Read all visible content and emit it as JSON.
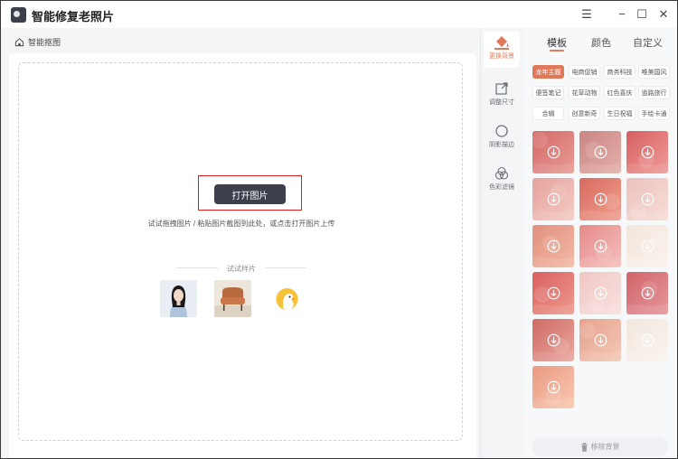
{
  "app": {
    "title": "智能修复老照片"
  },
  "window_controls": {
    "menu": "☰",
    "minimize": "−",
    "maximize": "☐",
    "close": "✕"
  },
  "breadcrumb": {
    "label": "智能抠图"
  },
  "main": {
    "open_button": "打开图片",
    "hint": "试试拖拽图片 / 粘贴图片截图到此处，或点击打开图片上传",
    "samples_label": "试试样片",
    "samples": [
      {
        "name": "woman-portrait",
        "icon": "portrait-icon"
      },
      {
        "name": "armchair",
        "icon": "chair-icon"
      },
      {
        "name": "duck-cartoon",
        "icon": "duck-icon"
      }
    ]
  },
  "tools": [
    {
      "label": "更换背景",
      "icon": "paint-bucket-icon",
      "active": true
    },
    {
      "label": "调整尺寸",
      "icon": "resize-icon",
      "active": false
    },
    {
      "label": "阴影描边",
      "icon": "shadow-stroke-icon",
      "active": false
    },
    {
      "label": "色彩滤镜",
      "icon": "color-filter-icon",
      "active": false
    }
  ],
  "panel": {
    "tabs": [
      "模板",
      "颜色",
      "自定义"
    ],
    "active_tab": "模板",
    "categories": [
      "龙年主题",
      "电商促销",
      "商务科技",
      "唯美国风",
      "便签笔记",
      "花草动物",
      "红色喜庆",
      "道路旅行",
      "合辑",
      "创意新奇",
      "生日祝福",
      "手绘卡通"
    ],
    "active_category": "龙年主题",
    "templates_count": 16,
    "remove_bg": "移除背景"
  },
  "colors": {
    "accent": "#e0785a",
    "dark_button": "#3d3f4d",
    "highlight": "#e02020"
  }
}
